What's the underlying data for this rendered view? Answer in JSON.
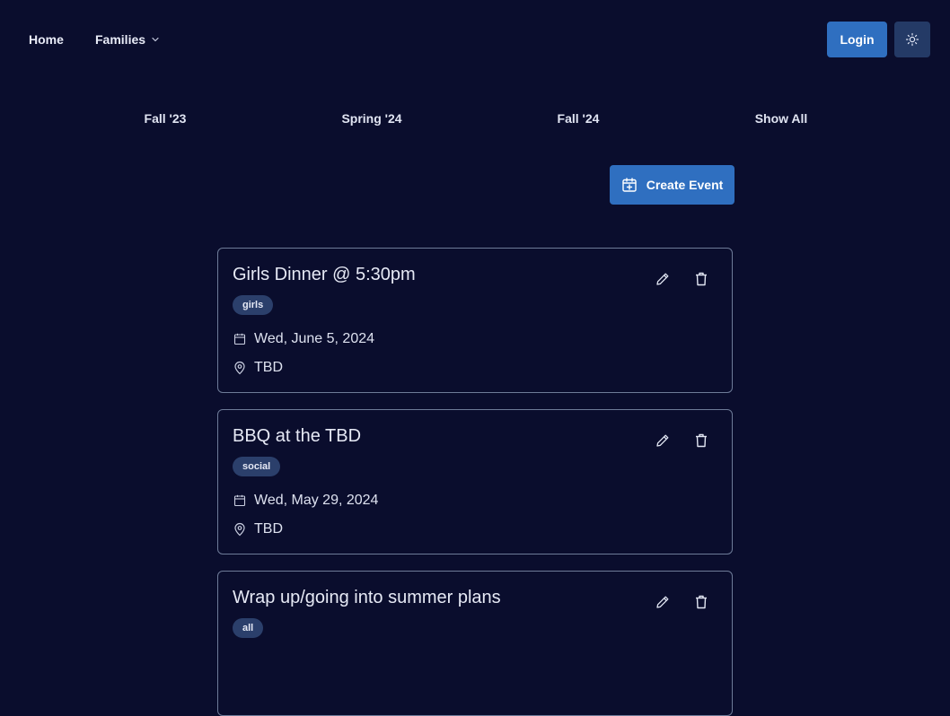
{
  "nav": {
    "home": "Home",
    "families": "Families",
    "login": "Login"
  },
  "seasons": [
    "Fall '23",
    "Spring '24",
    "Fall '24",
    "Show All"
  ],
  "create_event": "Create Event",
  "events": [
    {
      "title": "Girls Dinner @ 5:30pm",
      "tag": "girls",
      "date": "Wed, June 5, 2024",
      "location": "TBD"
    },
    {
      "title": "BBQ at the TBD",
      "tag": "social",
      "date": "Wed, May 29, 2024",
      "location": "TBD"
    },
    {
      "title": "Wrap up/going into summer plans",
      "tag": "all",
      "date": "",
      "location": ""
    }
  ],
  "colors": {
    "background": "#0a0d2d",
    "primary_button": "#2f6fc0",
    "theme_button": "#243a66",
    "tag_bg": "#2b3f6b",
    "card_border": "#6e7b98"
  },
  "icons": {
    "theme_toggle": "sun-icon",
    "families_dropdown": "chevron-down-icon",
    "create_event": "calendar-plus-icon",
    "edit": "pencil-icon",
    "delete": "trash-icon",
    "date": "calendar-icon",
    "location": "map-pin-icon"
  }
}
